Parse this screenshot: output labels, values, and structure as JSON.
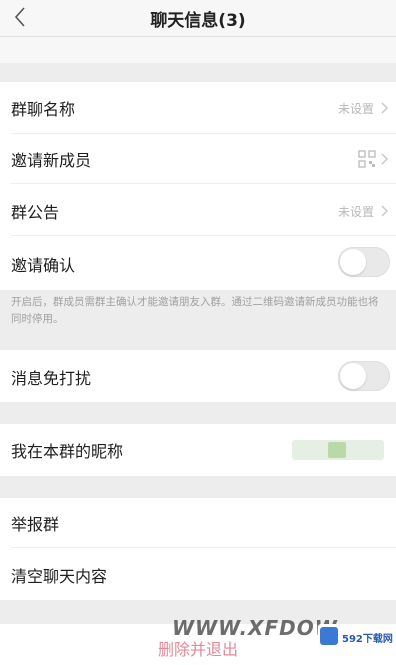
{
  "header": {
    "title": "聊天信息(3)",
    "back_icon": "chevron-left-icon"
  },
  "group_name": {
    "label": "群聊名称",
    "value": "未设置"
  },
  "invite_members": {
    "label": "邀请新成员",
    "icon": "qr-code-icon"
  },
  "announcement": {
    "label": "群公告",
    "value": "未设置"
  },
  "invite_confirm": {
    "label": "邀请确认",
    "enabled": false,
    "hint": "开启后，群成员需群主确认才能邀请朋友入群。通过二维码邀请新成员功能也将同时停用。"
  },
  "mute": {
    "label": "消息免打扰",
    "enabled": false
  },
  "nickname": {
    "label": "我在本群的昵称"
  },
  "report": {
    "label": "举报群"
  },
  "clear_history": {
    "label": "清空聊天内容"
  },
  "delete_exit": {
    "label": "删除并退出",
    "color": "#e08a9a"
  },
  "watermark": {
    "text": "WWW.XFDOW",
    "logo_text": "592下载网"
  }
}
